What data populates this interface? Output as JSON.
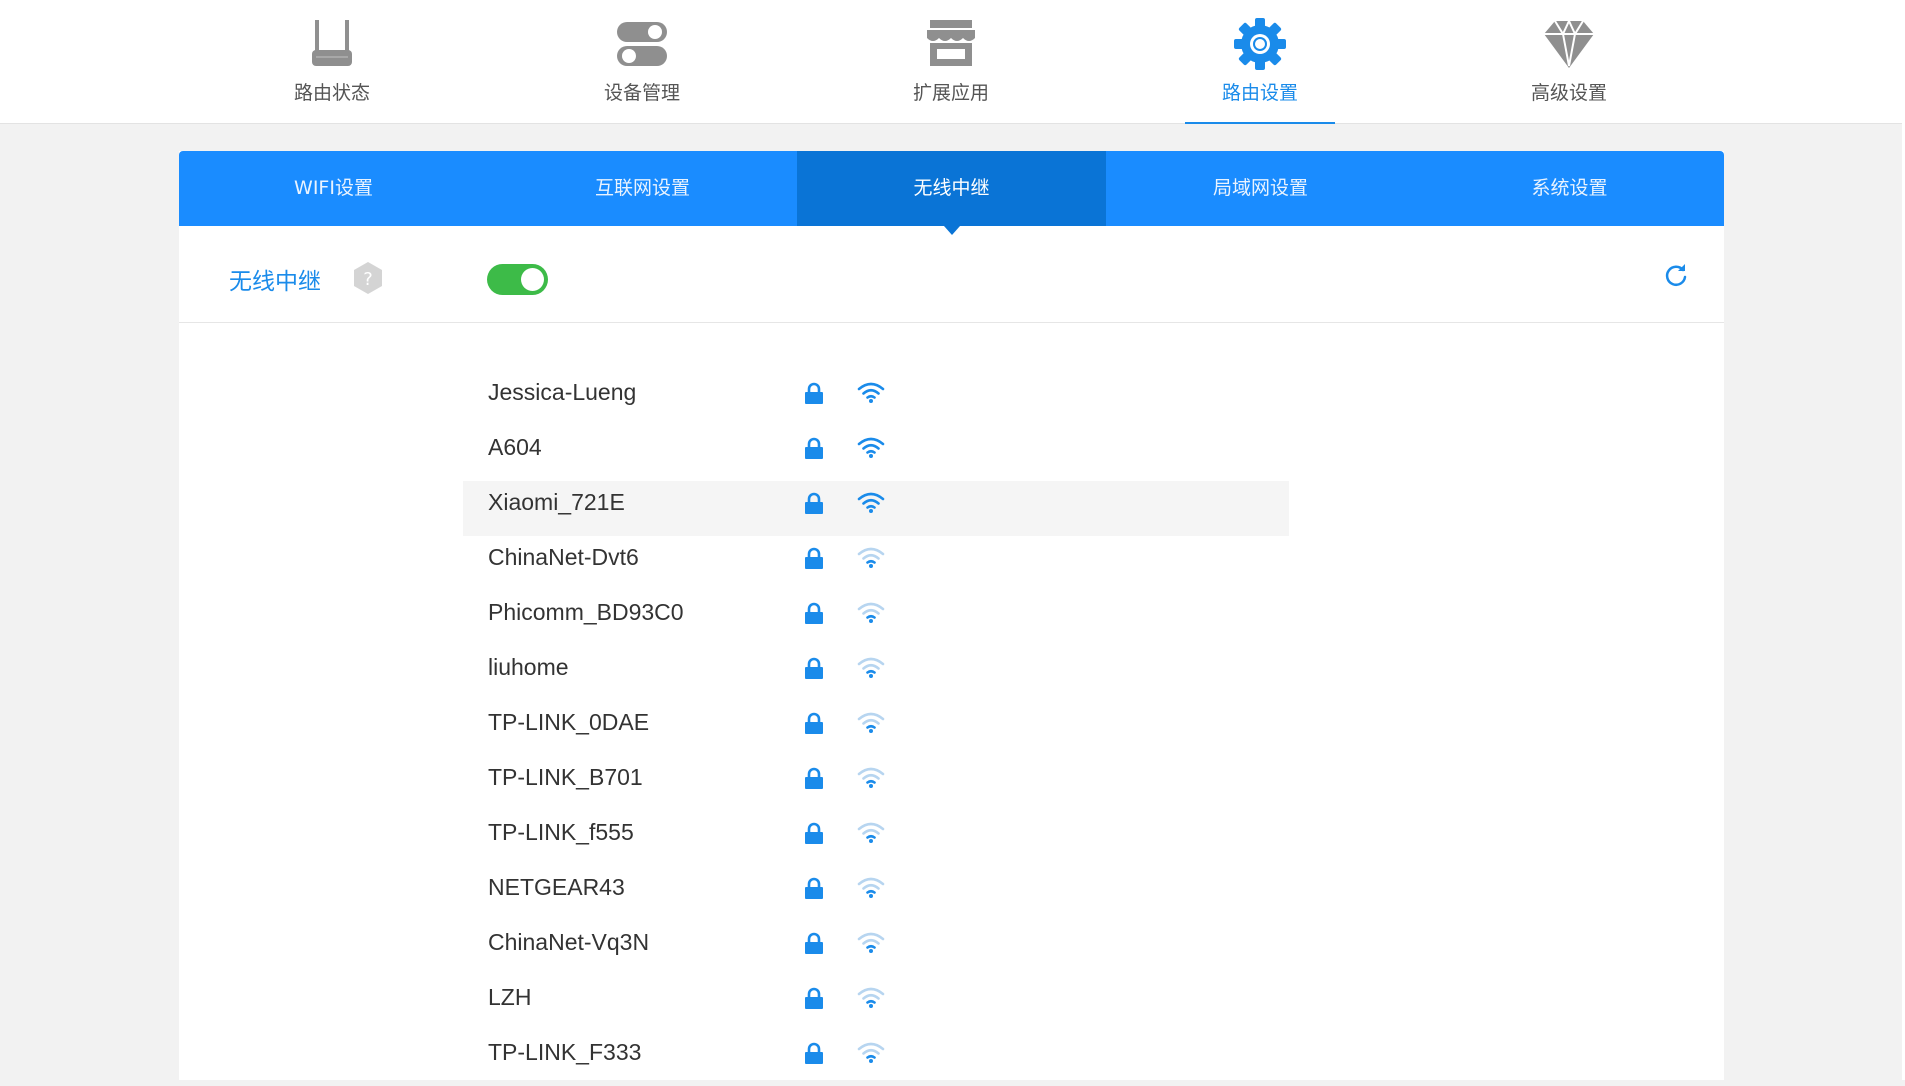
{
  "topnav": {
    "items": [
      {
        "label": "路由状态",
        "icon": "router-icon",
        "active": false
      },
      {
        "label": "设备管理",
        "icon": "toggle-switches-icon",
        "active": false
      },
      {
        "label": "扩展应用",
        "icon": "store-icon",
        "active": false
      },
      {
        "label": "路由设置",
        "icon": "gear-icon",
        "active": true
      },
      {
        "label": "高级设置",
        "icon": "diamond-icon",
        "active": false
      }
    ]
  },
  "subtabs": [
    {
      "label": "WIFI设置",
      "active": false
    },
    {
      "label": "互联网设置",
      "active": false
    },
    {
      "label": "无线中继",
      "active": true
    },
    {
      "label": "局域网设置",
      "active": false
    },
    {
      "label": "系统设置",
      "active": false
    }
  ],
  "relay": {
    "title": "无线中继",
    "help_glyph": "?",
    "enabled": true
  },
  "colors": {
    "accent": "#1a8bea",
    "tabbar": "#1a8cff",
    "tab_active": "#0a74d6",
    "toggle_on": "#3dbb48",
    "wifi_strong": "#1a8bea",
    "wifi_weak": "#b7d5f0"
  },
  "networks": [
    {
      "ssid": "Jessica-Lueng",
      "secured": true,
      "signal": "strong"
    },
    {
      "ssid": "A604",
      "secured": true,
      "signal": "strong"
    },
    {
      "ssid": "Xiaomi_721E",
      "secured": true,
      "signal": "strong"
    },
    {
      "ssid": "ChinaNet-Dvt6",
      "secured": true,
      "signal": "weak"
    },
    {
      "ssid": "Phicomm_BD93C0",
      "secured": true,
      "signal": "weak"
    },
    {
      "ssid": "liuhome",
      "secured": true,
      "signal": "weak"
    },
    {
      "ssid": "TP-LINK_0DAE",
      "secured": true,
      "signal": "weak"
    },
    {
      "ssid": "TP-LINK_B701",
      "secured": true,
      "signal": "weak"
    },
    {
      "ssid": "TP-LINK_f555",
      "secured": true,
      "signal": "weak"
    },
    {
      "ssid": "NETGEAR43",
      "secured": true,
      "signal": "weak"
    },
    {
      "ssid": "ChinaNet-Vq3N",
      "secured": true,
      "signal": "weak"
    },
    {
      "ssid": "LZH",
      "secured": true,
      "signal": "weak"
    },
    {
      "ssid": "TP-LINK_F333",
      "secured": true,
      "signal": "weak"
    }
  ]
}
